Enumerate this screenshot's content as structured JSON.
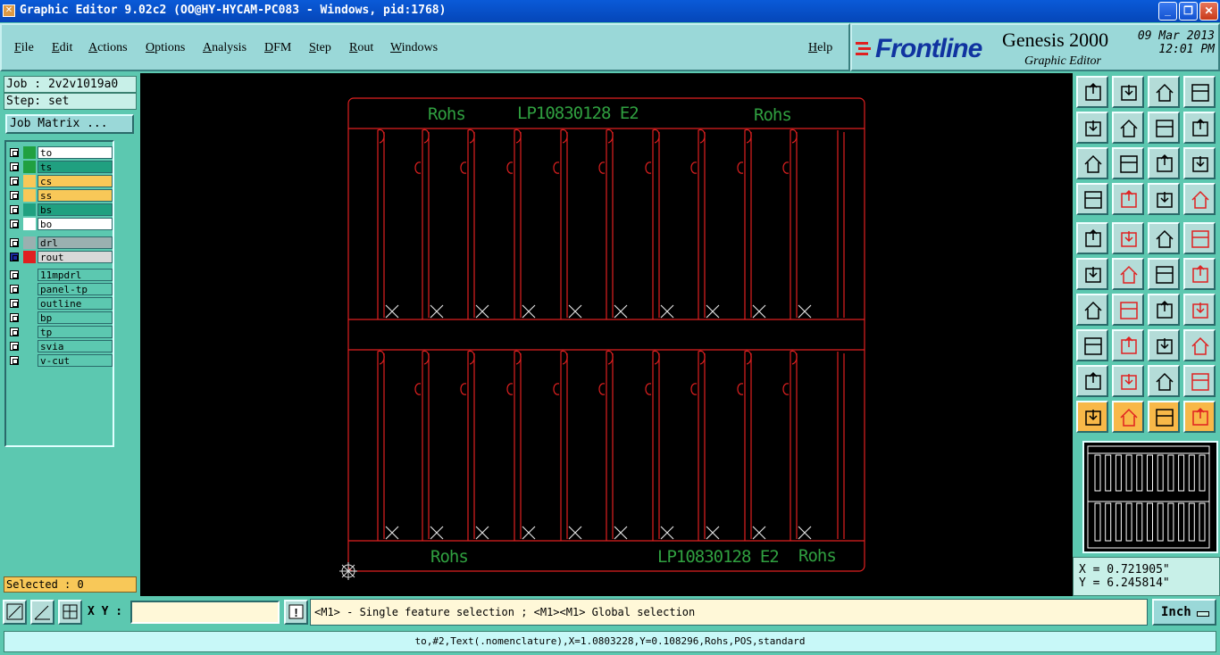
{
  "window": {
    "title": "Graphic Editor 9.02c2 (OO@HY-HYCAM-PC083 - Windows, pid:1768)",
    "controls": [
      "minimize",
      "restore",
      "close"
    ]
  },
  "menu": {
    "items": [
      "File",
      "Edit",
      "Actions",
      "Options",
      "Analysis",
      "DFM",
      "Step",
      "Rout",
      "Windows"
    ],
    "help": "Help"
  },
  "branding": {
    "brand": "Frontline",
    "product": "Genesis 2000",
    "subtitle": "Graphic Editor",
    "date": "09 Mar 2013",
    "time": "12:01 PM"
  },
  "job": {
    "job_label": "Job : 2v2v1019a0",
    "step_label": "Step: set",
    "matrix_button": "Job Matrix ..."
  },
  "layers": [
    {
      "name": "to",
      "color": "#20a040",
      "bg": "#ffffff"
    },
    {
      "name": "ts",
      "color": "#20a040",
      "bg": "#20a080"
    },
    {
      "name": "cs",
      "color": "#f8c858",
      "bg": "#f8c858"
    },
    {
      "name": "ss",
      "color": "#f8c858",
      "bg": "#f8c858"
    },
    {
      "name": "bs",
      "color": "#20a080",
      "bg": "#20a080"
    },
    {
      "name": "bo",
      "color": "#ffffff",
      "bg": "#ffffff"
    },
    {
      "name": "drl",
      "color": "#9ab0b0",
      "bg": "#9ab0b0"
    },
    {
      "name": "rout",
      "color": "#e02020",
      "bg": "#d8d8d8"
    },
    {
      "name": "11mpdrl",
      "color": "#5cc8b0",
      "bg": "#5cc8b0"
    },
    {
      "name": "panel-tp",
      "color": "#5cc8b0",
      "bg": "#5cc8b0"
    },
    {
      "name": "outline",
      "color": "#5cc8b0",
      "bg": "#5cc8b0"
    },
    {
      "name": "bp",
      "color": "#5cc8b0",
      "bg": "#5cc8b0"
    },
    {
      "name": "tp",
      "color": "#5cc8b0",
      "bg": "#5cc8b0"
    },
    {
      "name": "svia",
      "color": "#5cc8b0",
      "bg": "#5cc8b0"
    },
    {
      "name": "v-cut",
      "color": "#5cc8b0",
      "bg": "#5cc8b0"
    }
  ],
  "selected": "Selected : 0",
  "canvas": {
    "top_texts": [
      "Rohs",
      "LP10830128 E2",
      "Rohs"
    ],
    "bottom_texts": [
      "Rohs",
      "LP10830128 E2",
      "Rohs"
    ],
    "outline_color": "#e02020",
    "text_color": "#30a040",
    "marker_color": "#e0e0e0"
  },
  "coords": {
    "x": "X = 0.721905\"",
    "y": "Y = 6.245814\""
  },
  "bottom": {
    "xy_label": "X Y :",
    "xy_value": "",
    "hint": "<M1> - Single feature selection ; <M1><M1> Global selection",
    "units": "Inch"
  },
  "status": "to,#2,Text(.nomenclature),X=1.0803228,Y=0.108296,Rohs,POS,standard"
}
